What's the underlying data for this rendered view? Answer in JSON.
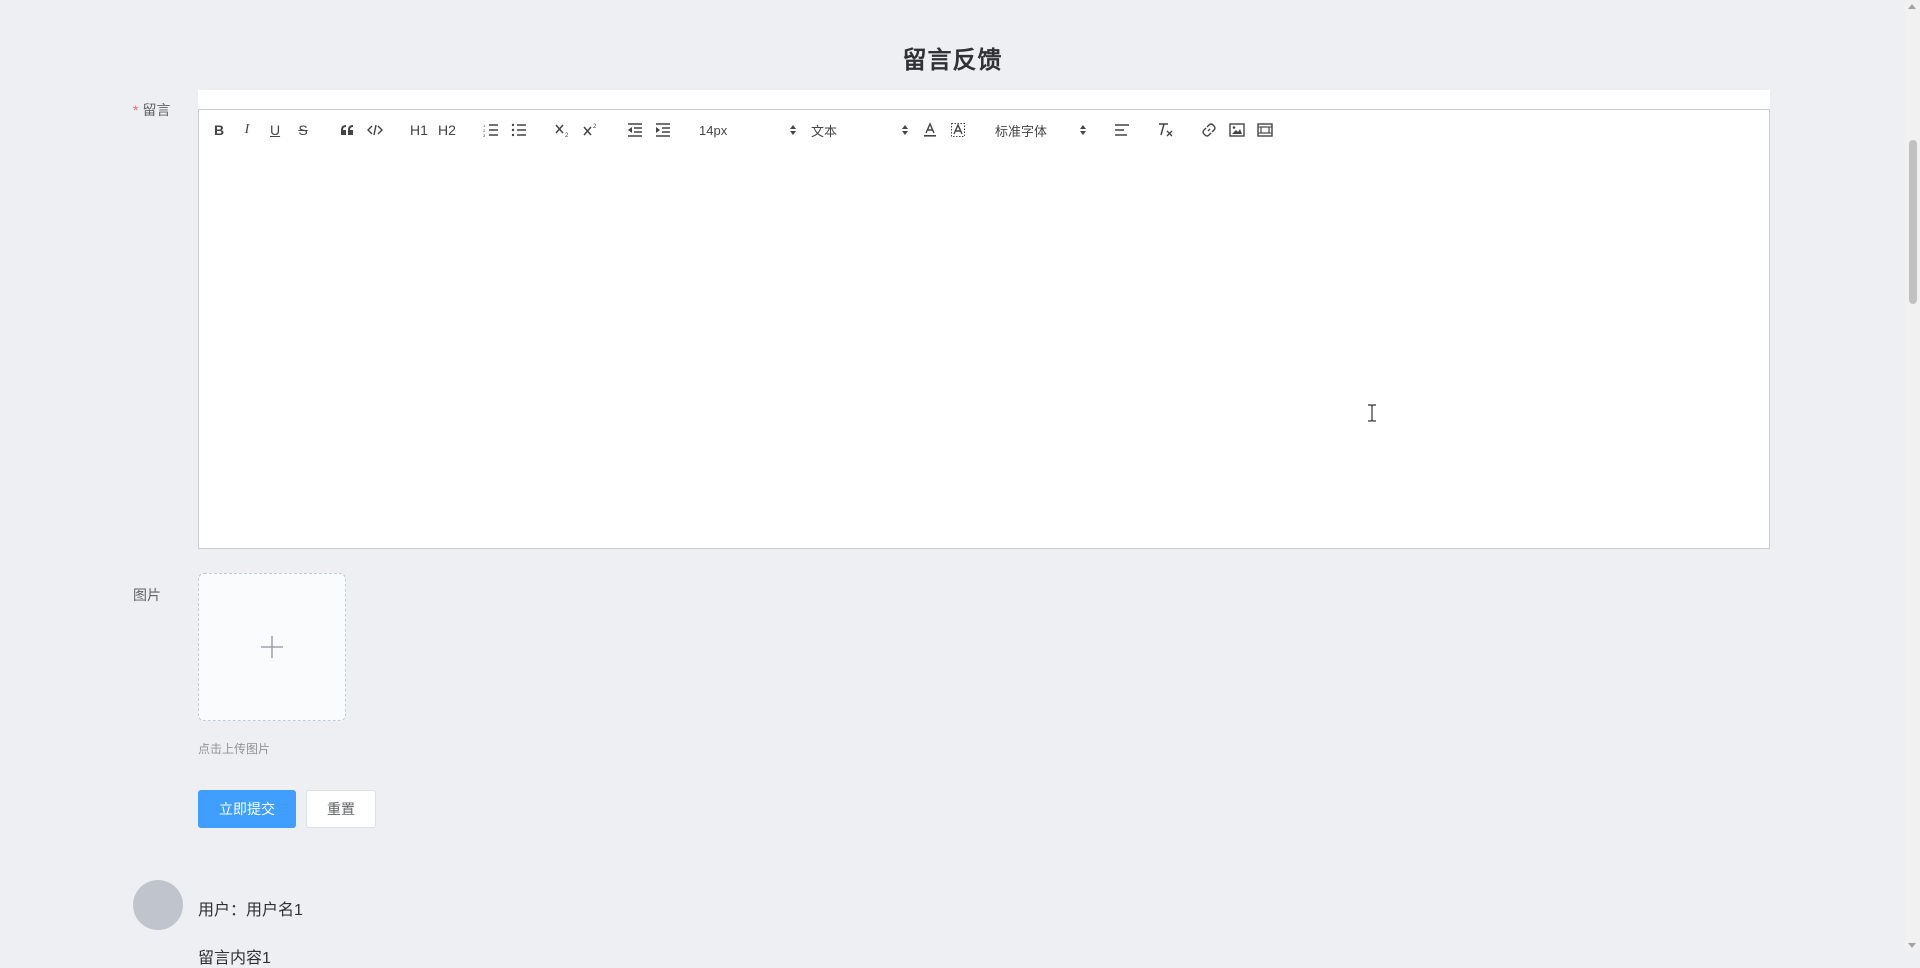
{
  "page": {
    "title": "留言反馈"
  },
  "form": {
    "message_label": "留言",
    "required_mark": "*",
    "image_label": "图片",
    "upload_hint": "点击上传图片",
    "submit_label": "立即提交",
    "reset_label": "重置"
  },
  "toolbar": {
    "size_value": "14px",
    "header_value": "文本",
    "font_value": "标准字体",
    "bold": "B",
    "italic": "I",
    "underline": "U",
    "strike": "S",
    "h1": "H1",
    "h2": "H2",
    "icons": [
      "bold-icon",
      "italic-icon",
      "underline-icon",
      "strike-icon",
      "quote-icon",
      "code-icon",
      "h1-icon",
      "h2-icon",
      "ordered-list-icon",
      "bullet-list-icon",
      "subscript-icon",
      "superscript-icon",
      "outdent-icon",
      "indent-icon",
      "font-color-icon",
      "background-color-icon",
      "align-icon",
      "clear-format-icon",
      "link-icon",
      "image-icon",
      "video-icon"
    ]
  },
  "comments": [
    {
      "user": "用户：用户名1",
      "content": "留言内容1"
    }
  ],
  "colors": {
    "primary": "#409eff",
    "background": "#eeeff2",
    "required": "#f56c6c"
  }
}
